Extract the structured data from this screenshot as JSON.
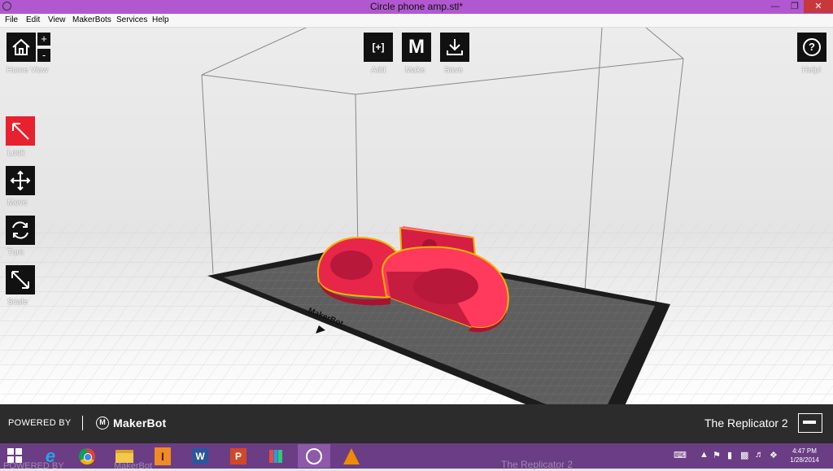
{
  "window": {
    "title": "Circle phone amp.stl*"
  },
  "menu": {
    "items": [
      "File",
      "Edit",
      "View",
      "MakerBots",
      "Services",
      "Help"
    ]
  },
  "toolbar": {
    "home_label": "Home View",
    "zoom_in": "+",
    "zoom_out": "-",
    "add_label": "Add",
    "add_glyph": "[+]",
    "make_label": "Make",
    "make_glyph": "M",
    "save_label": "Save",
    "help_label": "Help!",
    "help_glyph": "?"
  },
  "tools": [
    {
      "label": "Look",
      "icon": "look-arrow-icon",
      "active": true
    },
    {
      "label": "Move",
      "icon": "move-arrows-icon",
      "active": false
    },
    {
      "label": "Turn",
      "icon": "rotate-icon",
      "active": false
    },
    {
      "label": "Scale",
      "icon": "scale-icon",
      "active": false
    }
  ],
  "platform": {
    "brand": "MakerBot"
  },
  "bottom": {
    "powered": "POWERED BY",
    "brand": "MakerBot",
    "brand_mark": "M",
    "printer": "The Replicator 2"
  },
  "taskbar": {
    "items": [
      "internet-explorer-icon",
      "chrome-icon",
      "file-explorer-icon",
      "illustrator-icon",
      "word-icon",
      "powerpoint-icon",
      "apps-icon",
      "makerware-icon",
      "vlc-icon"
    ],
    "ghost_powered": "POWERED BY",
    "ghost_brand": "MakerBot",
    "ghost_printer": "The Replicator 2",
    "clock_time": "4:47 PM",
    "clock_date": "1/28/2014"
  },
  "colors": {
    "accent": "#e8212e",
    "model": "#e8264a",
    "title_bar": "#b158d1",
    "taskbar": "#6b3d84"
  }
}
